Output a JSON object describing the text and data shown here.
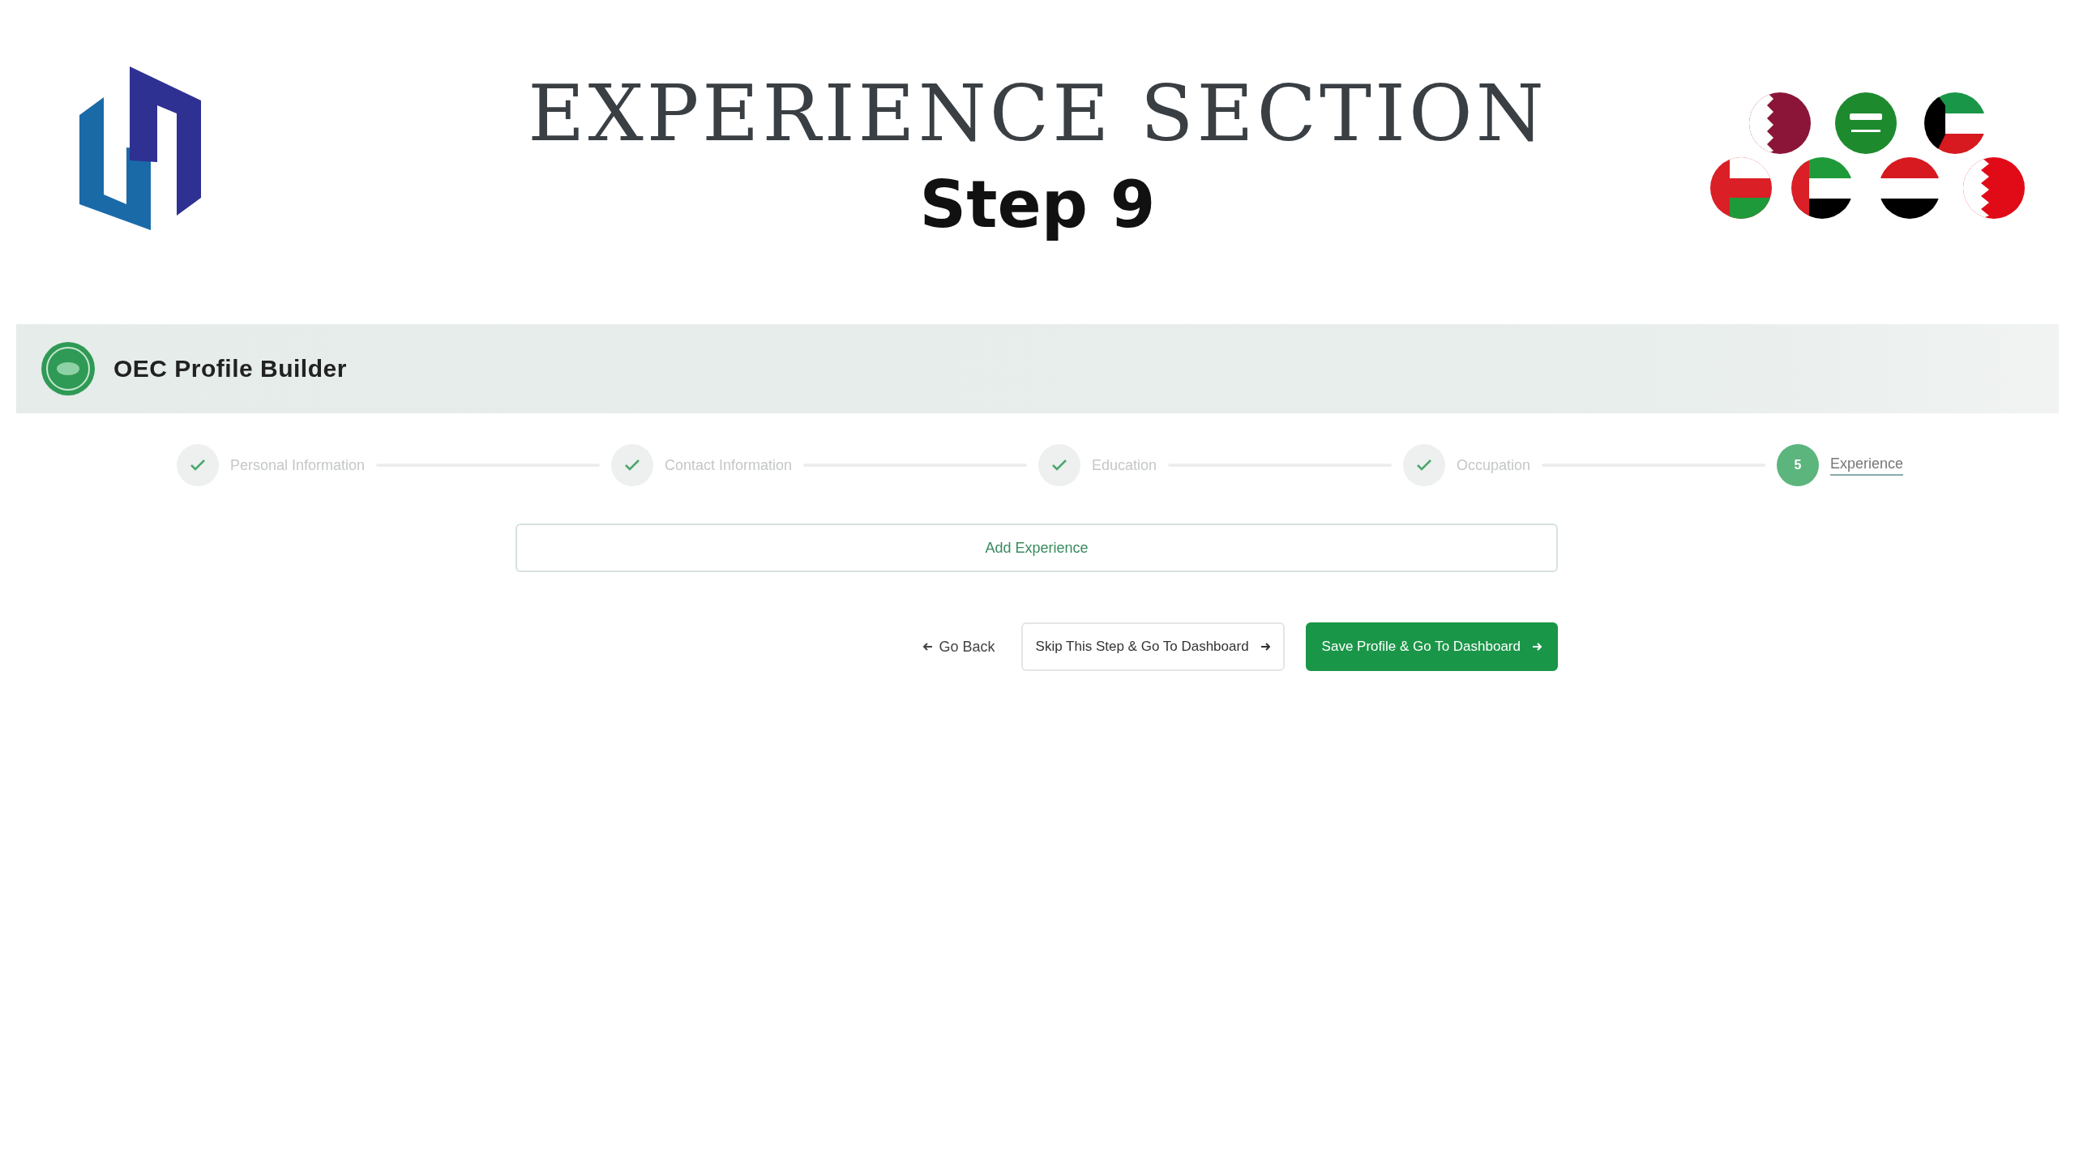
{
  "banner": {
    "title": "EXPERIENCE SECTION",
    "subtitle": "Step 9"
  },
  "app_bar": {
    "title": "OEC Profile Builder"
  },
  "steps": [
    {
      "label": "Personal Information",
      "completed": true,
      "selected": false
    },
    {
      "label": "Contact Information",
      "completed": true,
      "selected": false
    },
    {
      "label": "Education",
      "completed": true,
      "selected": false
    },
    {
      "label": "Occupation",
      "completed": true,
      "selected": false
    },
    {
      "label": "Experience",
      "completed": false,
      "selected": true,
      "number": "5"
    }
  ],
  "add_button": "Add Experience",
  "actions": [
    {
      "kind": "link",
      "label": "Go Back"
    },
    {
      "kind": "outline",
      "label": "Skip This Step & Go To Dashboard"
    },
    {
      "kind": "primary",
      "label": "Save Profile & Go To Dashboard"
    }
  ]
}
